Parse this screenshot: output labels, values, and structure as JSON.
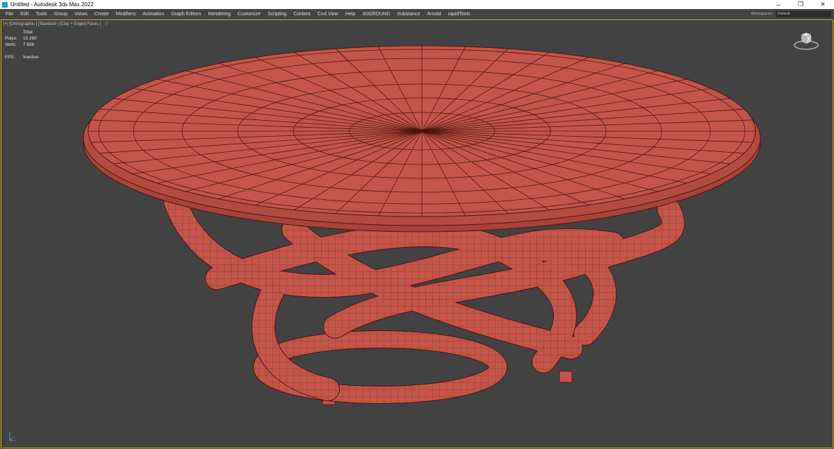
{
  "window": {
    "title": "Untitled - Autodesk 3ds Max 2022",
    "controls": [
      "─",
      "❐",
      "✕"
    ]
  },
  "menu": {
    "items": [
      "File",
      "Edit",
      "Tools",
      "Group",
      "Views",
      "Create",
      "Modifiers",
      "Animation",
      "Graph Editors",
      "Rendering",
      "Customize",
      "Scripting",
      "Content",
      "Civil View",
      "Help",
      "3DGROUND",
      "Substance",
      "Arnold",
      "rapidTools"
    ],
    "workspaces_label": "Workspaces:",
    "workspaces_value": "Default"
  },
  "viewport": {
    "label": "[+] [Orthographic ] [Standard ] [Clay + Edged Faces ]",
    "filter_icon": "filter-icon",
    "stats": {
      "header": "Total",
      "polys_label": "Polys:",
      "polys_value": "15 280",
      "verts_label": "Verts:",
      "verts_value": "7 636",
      "fps_label": "FPS:",
      "fps_value": "Inactive"
    },
    "model_color": "#c4554a",
    "edge_color": "#4a1410",
    "background_color": "#424242",
    "active_border_color": "#c8b800"
  }
}
